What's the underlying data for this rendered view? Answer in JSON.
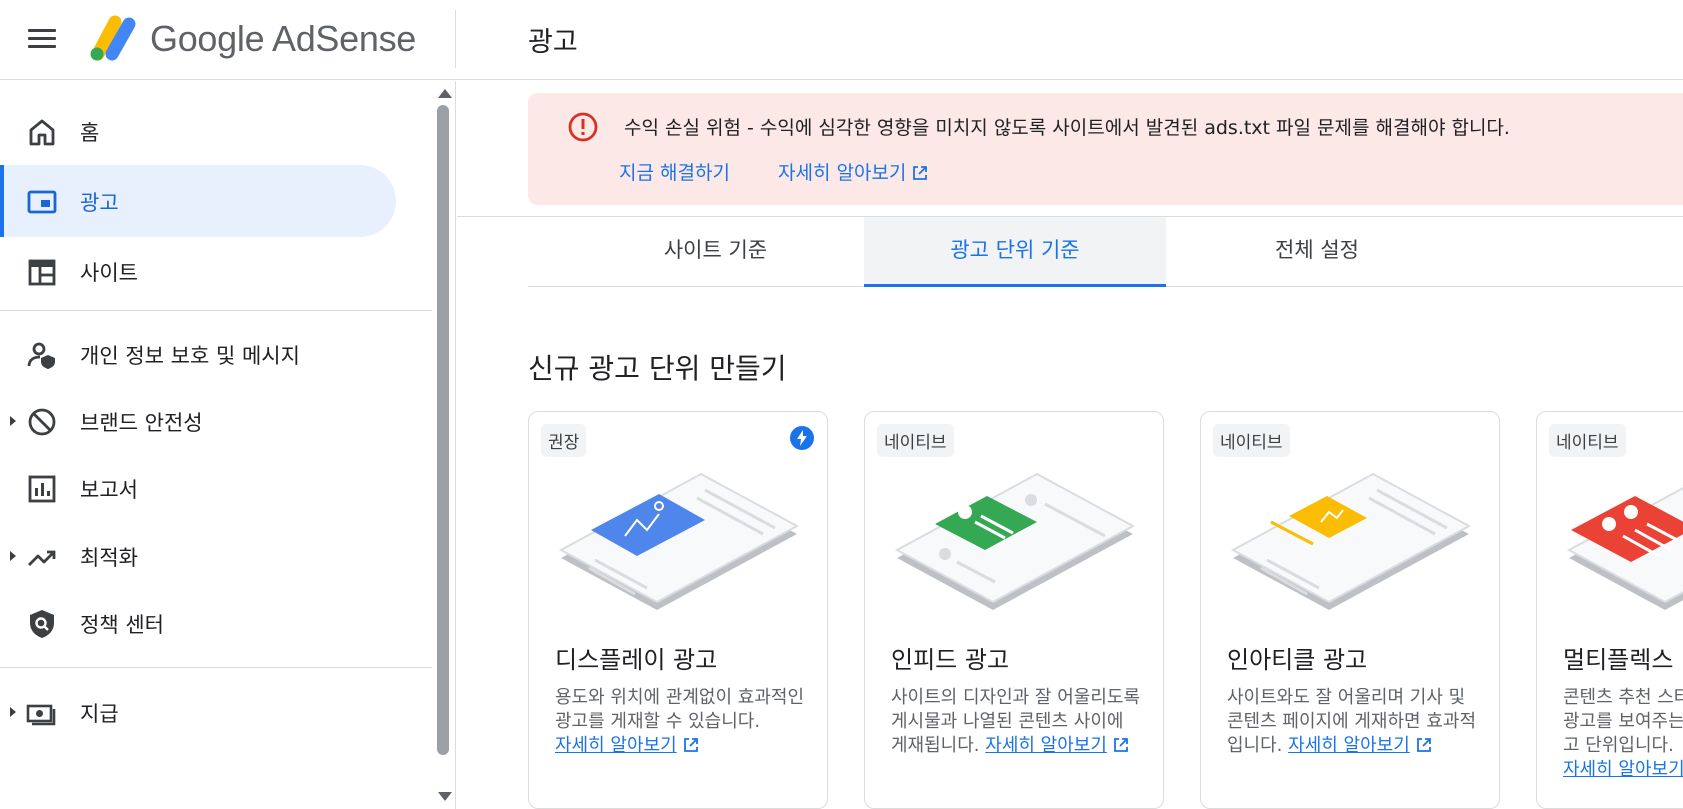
{
  "header": {
    "brand": "Google AdSense",
    "page_title": "광고"
  },
  "sidebar": {
    "items": [
      {
        "label": "홈",
        "icon": "home-icon"
      },
      {
        "label": "광고",
        "icon": "ads-icon",
        "active": true
      },
      {
        "label": "사이트",
        "icon": "sites-icon"
      },
      {
        "label": "개인 정보 보호 및 메시지",
        "icon": "privacy-icon"
      },
      {
        "label": "브랜드 안전성",
        "icon": "block-icon",
        "expandable": true
      },
      {
        "label": "보고서",
        "icon": "reports-icon"
      },
      {
        "label": "최적화",
        "icon": "trending-icon",
        "expandable": true
      },
      {
        "label": "정책 센터",
        "icon": "policy-shield-icon"
      },
      {
        "label": "지급",
        "icon": "payments-icon",
        "expandable": true
      }
    ]
  },
  "alert": {
    "message": "수익 손실 위험 - 수익에 심각한 영향을 미치지 않도록 사이트에서 발견된 ads.txt 파일 문제를 해결해야 합니다.",
    "fix_label": "지금 해결하기",
    "learn_label": "자세히 알아보기",
    "color": "#fce8e6"
  },
  "tabs": [
    {
      "label": "사이트 기준"
    },
    {
      "label": "광고 단위 기준",
      "active": true
    },
    {
      "label": "전체 설정"
    }
  ],
  "section_title": "신규 광고 단위 만들기",
  "cards": [
    {
      "badge": "권장",
      "title": "디스플레이 광고",
      "desc": "용도와 위치에 관계없이 효과적인 광고를 게재할 수 있습니다.",
      "link": "자세히 알아보기",
      "accent": "#4f86ec"
    },
    {
      "badge": "네이티브",
      "title": "인피드 광고",
      "desc": "사이트의 디자인과 잘 어울리도록 게시물과 나열된 콘텐츠 사이에 게재됩니다.",
      "link": "자세히 알아보기",
      "accent": "#34a853"
    },
    {
      "badge": "네이티브",
      "title": "인아티클 광고",
      "desc": "사이트와도 잘 어울리며 기사 및 콘텐츠 페이지에 게재하면 효과적입니다.",
      "link": "자세히 알아보기",
      "accent": "#fbbc04"
    },
    {
      "badge": "네이티브",
      "title": "멀티플렉스",
      "desc": "콘텐츠 추천 스타일의 네이티브 광고를 보여주는 그리드 기반 광고 단위입니다.",
      "link": "자세히 알아보기",
      "accent": "#ea4335"
    }
  ],
  "colors": {
    "primary": "#1a73e8",
    "active_bg": "#e8f0fe"
  }
}
